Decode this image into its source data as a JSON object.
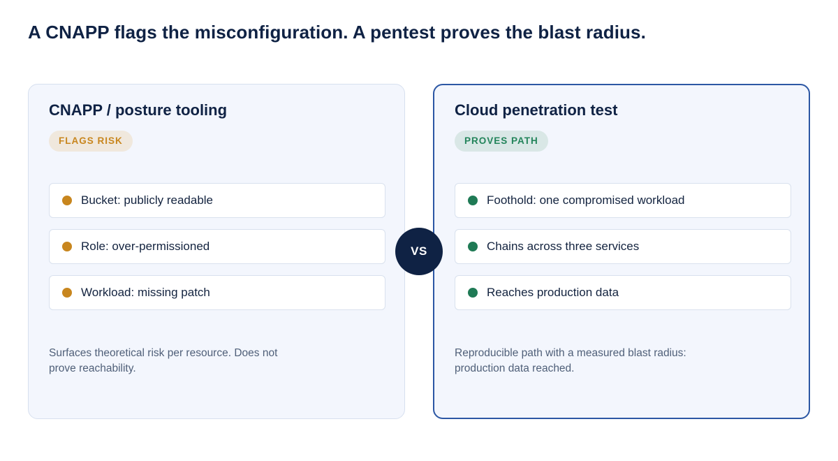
{
  "title": "A CNAPP flags the misconfiguration. A pentest proves the blast radius.",
  "vs_label": "VS",
  "colors": {
    "navy": "#0f2244",
    "warn_accent": "#c8861e",
    "good_accent": "#1f7a55",
    "right_border": "#2c57a4"
  },
  "left": {
    "title": "CNAPP / posture tooling",
    "badge": "FLAGS RISK",
    "items": [
      {
        "label": "Bucket: publicly readable"
      },
      {
        "label": "Role: over-permissioned"
      },
      {
        "label": "Workload: missing patch"
      }
    ],
    "note": "Surfaces theoretical risk per resource. Does not prove reachability."
  },
  "right": {
    "title": "Cloud penetration test",
    "badge": "PROVES PATH",
    "items": [
      {
        "label": "Foothold: one compromised workload"
      },
      {
        "label": "Chains across three services"
      },
      {
        "label": "Reaches production data"
      }
    ],
    "note": "Reproducible path with a measured blast radius: production data reached."
  }
}
